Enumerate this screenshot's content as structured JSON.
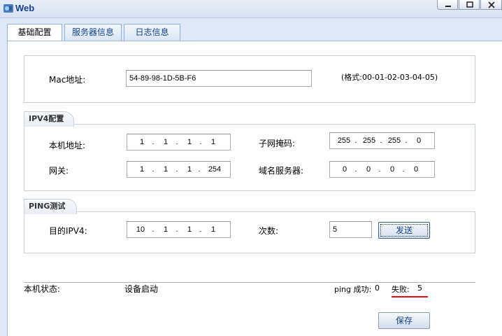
{
  "window": {
    "title": "Web"
  },
  "tabs": [
    {
      "label": "基础配置",
      "active": true
    },
    {
      "label": "服务器信息",
      "active": false
    },
    {
      "label": "日志信息",
      "active": false
    }
  ],
  "mac": {
    "label": "Mac地址:",
    "value": "54-89-98-1D-5B-F6",
    "format_hint": "(格式:00-01-02-03-04-05)"
  },
  "ipv4": {
    "legend": "IPV4配置",
    "local_ip": {
      "label": "本机地址:",
      "octets": [
        "1",
        "1",
        "1",
        "1"
      ]
    },
    "subnet": {
      "label": "子网掩码:",
      "octets": [
        "255",
        "255",
        "255",
        "0"
      ]
    },
    "gateway": {
      "label": "网关:",
      "octets": [
        "1",
        "1",
        "1",
        "254"
      ]
    },
    "dns": {
      "label": "域名服务器:",
      "octets": [
        "0",
        "0",
        "0",
        "0"
      ]
    }
  },
  "ping": {
    "legend": "PING测试",
    "target": {
      "label": "目的IPV4:",
      "octets": [
        "10",
        "1",
        "1",
        "1"
      ]
    },
    "count": {
      "label": "次数:",
      "value": "5"
    },
    "send_label": "发送"
  },
  "status": {
    "label": "本机状态:",
    "value": "设备启动",
    "ping_success_label": "ping 成功:",
    "ping_success_value": "0",
    "fail_label": "失败:",
    "fail_value": "5"
  },
  "save_label": "保存",
  "colors": {
    "accent": "#15428b",
    "underline": "#e01010"
  }
}
